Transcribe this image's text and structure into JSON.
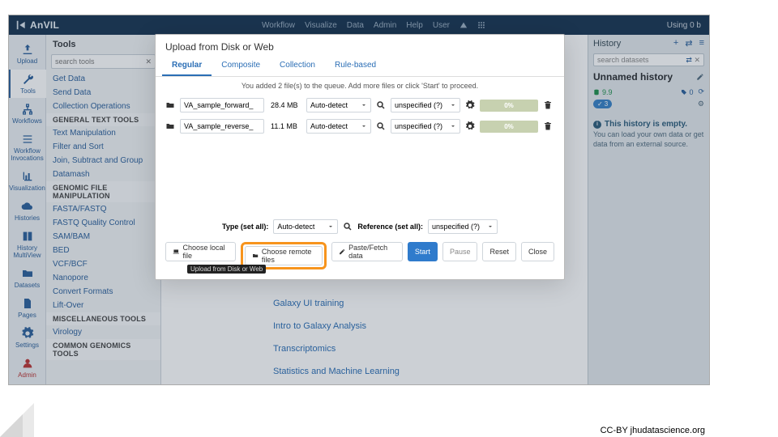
{
  "brand": "AnVIL",
  "top_menu": [
    "Workflow",
    "Visualize",
    "Data",
    "Admin",
    "Help",
    "User"
  ],
  "top_right": "Using 0 b",
  "leftnav": [
    {
      "icon": "upload",
      "label": "Upload"
    },
    {
      "icon": "wrench",
      "label": "Tools"
    },
    {
      "icon": "sitemap",
      "label": "Workflows"
    },
    {
      "icon": "list",
      "label": "Workflow Invocations"
    },
    {
      "icon": "chart",
      "label": "Visualization"
    },
    {
      "icon": "cloud",
      "label": "Histories"
    },
    {
      "icon": "book",
      "label": "History MultiView"
    },
    {
      "icon": "folder",
      "label": "Datasets"
    },
    {
      "icon": "file",
      "label": "Pages"
    },
    {
      "icon": "gear",
      "label": "Settings"
    },
    {
      "icon": "user",
      "label": "Admin"
    }
  ],
  "tools": {
    "title": "Tools",
    "search_placeholder": "search tools",
    "rows": [
      {
        "t": "cat",
        "l": "Get Data"
      },
      {
        "t": "cat",
        "l": "Send Data"
      },
      {
        "t": "cat",
        "l": "Collection Operations"
      },
      {
        "t": "hdr",
        "l": "GENERAL TEXT TOOLS"
      },
      {
        "t": "cat",
        "l": "Text Manipulation"
      },
      {
        "t": "cat",
        "l": "Filter and Sort"
      },
      {
        "t": "cat",
        "l": "Join, Subtract and Group"
      },
      {
        "t": "cat",
        "l": "Datamash"
      },
      {
        "t": "hdr",
        "l": "GENOMIC FILE MANIPULATION"
      },
      {
        "t": "cat",
        "l": "FASTA/FASTQ"
      },
      {
        "t": "cat",
        "l": "FASTQ Quality Control"
      },
      {
        "t": "cat",
        "l": "SAM/BAM"
      },
      {
        "t": "cat",
        "l": "BED"
      },
      {
        "t": "cat",
        "l": "VCF/BCF"
      },
      {
        "t": "cat",
        "l": "Nanopore"
      },
      {
        "t": "cat",
        "l": "Convert Formats"
      },
      {
        "t": "cat",
        "l": "Lift-Over"
      },
      {
        "t": "hdr",
        "l": "MISCELLANEOUS TOOLS"
      },
      {
        "t": "cat",
        "l": "Virology"
      },
      {
        "t": "hdr",
        "l": "COMMON GENOMICS TOOLS"
      }
    ]
  },
  "main_links": [
    "Galaxy UI training",
    "Intro to Galaxy Analysis",
    "Transcriptomics",
    "Statistics and Machine Learning"
  ],
  "tooltip": "Upload from Disk or Web",
  "history": {
    "title": "History",
    "search_placeholder": "search datasets",
    "name": "Unnamed history",
    "stat_green": "9.9",
    "stat_blue_badge": "3",
    "tags_count": "0",
    "empty_title": "This history is empty.",
    "empty_text": "You can load your own data or get data from an external source."
  },
  "modal": {
    "title": "Upload from Disk or Web",
    "tabs": [
      "Regular",
      "Composite",
      "Collection",
      "Rule-based"
    ],
    "note": "You added 2 file(s) to the queue. Add more files or click 'Start' to proceed.",
    "files": [
      {
        "name": "VA_sample_forward_",
        "size": "28.4 MB",
        "type": "Auto-detect",
        "ref": "unspecified (?)",
        "progress": "0%"
      },
      {
        "name": "VA_sample_reverse_",
        "size": "11.1 MB",
        "type": "Auto-detect",
        "ref": "unspecified (?)",
        "progress": "0%"
      }
    ],
    "type_label": "Type (set all):",
    "type_value": "Auto-detect",
    "ref_label": "Reference (set all):",
    "ref_value": "unspecified (?)",
    "buttons": {
      "local": "Choose local file",
      "remote": "Choose remote files",
      "paste": "Paste/Fetch data",
      "start": "Start",
      "pause": "Pause",
      "reset": "Reset",
      "close": "Close"
    }
  },
  "footer": "CC-BY  jhudatascience.org"
}
